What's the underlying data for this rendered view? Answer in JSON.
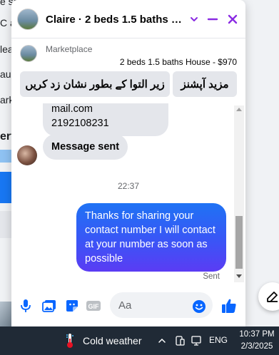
{
  "background": {
    "fragments": [
      "e square feet",
      "C a",
      "lea",
      "aur",
      "ark",
      "ert"
    ]
  },
  "chat": {
    "title": "Claire · 2 beds 1.5 baths H...",
    "marketplace_label": "Marketplace",
    "listing_summary": "2 beds 1.5 baths House - $970",
    "actions": {
      "mark_pending": "زیر التوا کے بطور نشان زد کریں",
      "more_options": "مزید آپشنز"
    },
    "messages": {
      "partial_line1": "mail.com",
      "partial_line2": "2192108231",
      "message_sent": "Message sent",
      "time_separator": "22:37",
      "outgoing": "Thanks for sharing your contact number I will contact at your number as soon as possible",
      "sent_status": "Sent"
    },
    "composer": {
      "placeholder": "Aa"
    }
  },
  "taskbar": {
    "weather": "Cold weather",
    "language": "ENG",
    "time": "10:37 PM",
    "date": "2/3/2025"
  },
  "colors": {
    "accent": "#8a2be2",
    "messenger_blue": "#0866ff",
    "taskbar_bg": "#202a36"
  }
}
